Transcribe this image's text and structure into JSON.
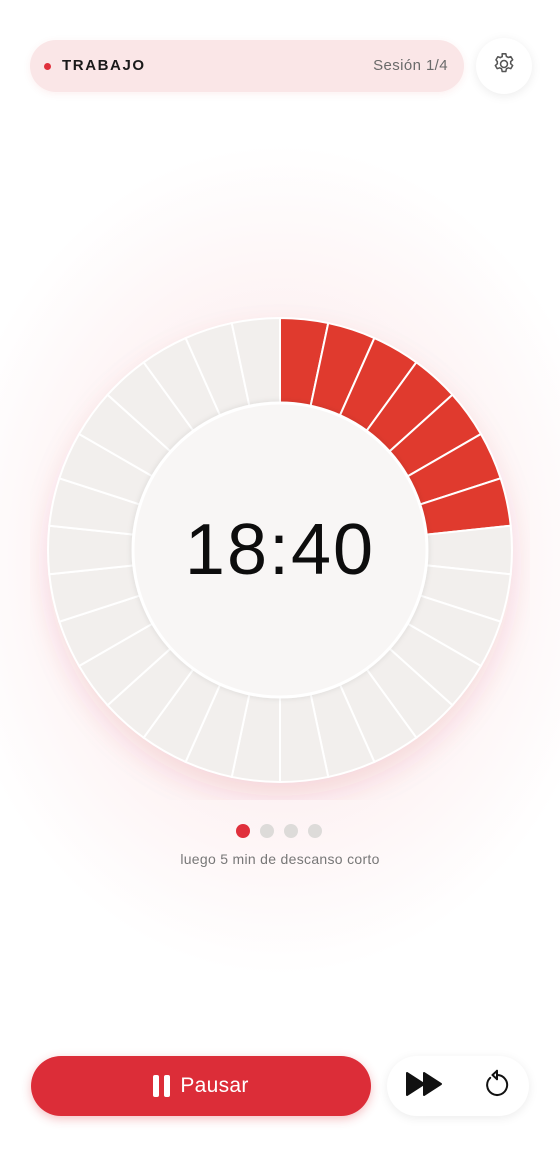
{
  "status": {
    "mode_label": "TRABAJO",
    "session_label": "Sesión 1/4"
  },
  "timer": {
    "time": "18:40",
    "total_segments": 30,
    "elapsed_segments": 7,
    "accent_color": "#e03a2e",
    "empty_color": "#f2efed"
  },
  "sessions": {
    "total": 4,
    "current": 1
  },
  "next_text": "luego 5 min de descanso corto",
  "controls": {
    "pause_label": "Pausar",
    "pause_icon": "pause-icon",
    "skip_icon": "fast-forward-icon",
    "reset_icon": "reset-icon",
    "settings_icon": "gear-icon"
  },
  "colors": {
    "accent": "#dc2d38",
    "pill_background": "#fae6e7"
  }
}
